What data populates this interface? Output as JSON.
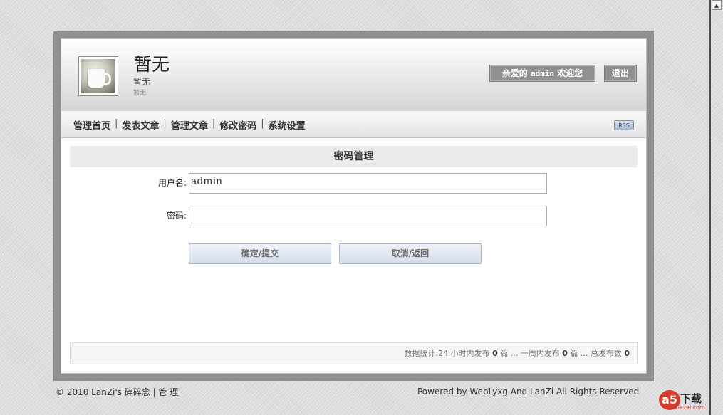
{
  "header": {
    "site_title": "暂无",
    "site_subtitle": "暂无",
    "site_description": "暂无",
    "welcome_prefix": "亲爱的",
    "welcome_user": "admin",
    "welcome_suffix": "欢迎您",
    "logout_label": "退出"
  },
  "nav": {
    "items": [
      "管理首页",
      "发表文章",
      "管理文章",
      "修改密码",
      "系统设置"
    ],
    "separator": "|",
    "rss_label": "RSS"
  },
  "form": {
    "title": "密码管理",
    "username_label": "用户名:",
    "username_value": "admin",
    "password_label": "密码:",
    "password_value": "",
    "submit_label": "确定/提交",
    "cancel_label": "取消/返回"
  },
  "stats": {
    "prefix": "数据统计:24 小时内发布",
    "day_count": "0",
    "unit1": "篇 ... 一周内发布",
    "week_count": "0",
    "unit2": "篇 ... 总发布数",
    "total_count": "0"
  },
  "footer": {
    "left_text": "© 2010 LanZi's 碎碎念",
    "left_sep": "|",
    "admin_link": "管 理",
    "right_text": "Powered by WebLyxg And LanZi All Rights Reserved"
  },
  "watermark": {
    "logo": "a5",
    "text": "下载",
    "domain": "xiazai.com"
  }
}
